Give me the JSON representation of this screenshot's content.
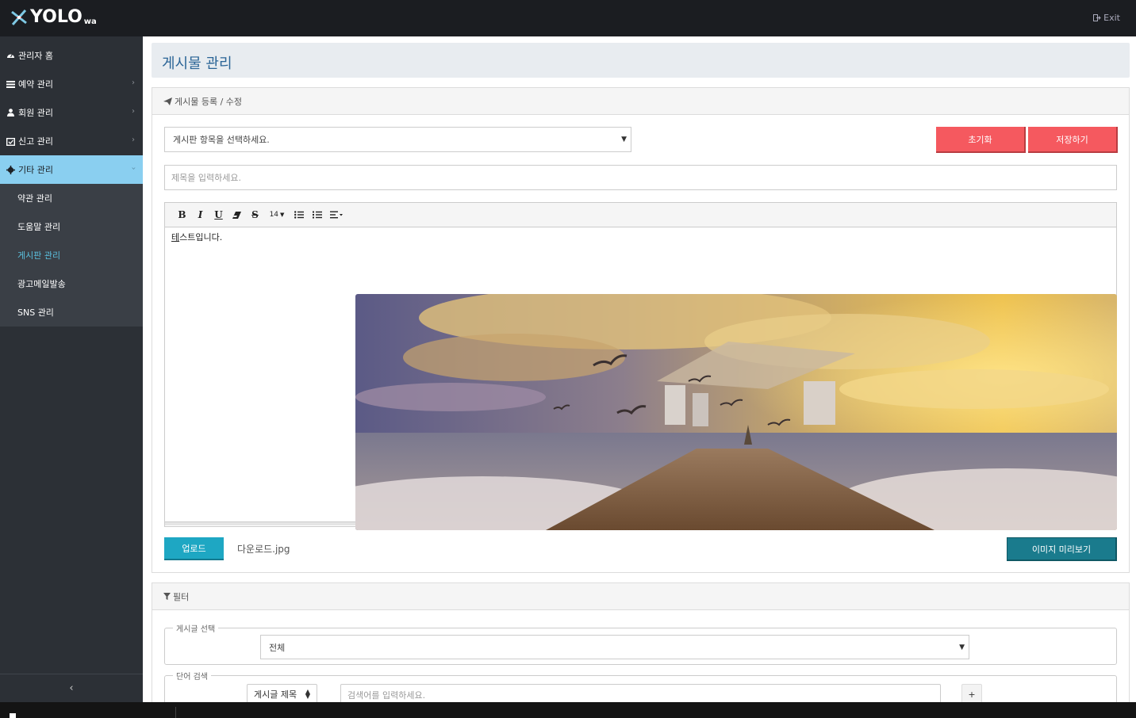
{
  "app": {
    "logo_text": "YOLO",
    "logo_sub": "wa",
    "exit_label": "Exit"
  },
  "sidebar": {
    "items": [
      {
        "label": "관리자 홈",
        "icon": "dashboard-icon",
        "has_chevron": false
      },
      {
        "label": "예약 관리",
        "icon": "list-icon",
        "has_chevron": true
      },
      {
        "label": "회원 관리",
        "icon": "user-icon",
        "has_chevron": true
      },
      {
        "label": "신고 관리",
        "icon": "calendar-check-icon",
        "has_chevron": true
      },
      {
        "label": "기타 관리",
        "icon": "gear-icon",
        "has_chevron": true,
        "active": true
      }
    ],
    "submenu": [
      {
        "label": "약관 관리"
      },
      {
        "label": "도움말 관리"
      },
      {
        "label": "게시판 관리",
        "current": true
      },
      {
        "label": "광고메일발송"
      },
      {
        "label": "SNS 관리"
      }
    ],
    "collapse_glyph": "‹"
  },
  "page": {
    "title": "게시물 관리"
  },
  "edit_panel": {
    "heading": "게시물 등록 / 수정",
    "board_select": "게시판 항목을 선택하세요.",
    "reset_button": "초기화",
    "save_button": "저장하기",
    "title_placeholder": "제목을 입력하세요.",
    "toolbar": {
      "bold": "B",
      "italic": "I",
      "underline": "U",
      "eraser": "eraser-icon",
      "strikethrough": "S",
      "font_size": "14",
      "unordered_list": "list-ul-icon",
      "ordered_list": "list-ol-icon",
      "align": "align-left-icon"
    },
    "editor_text_first": "테",
    "editor_text_rest": "스트입니다.",
    "upload_button": "업로드",
    "file_name": "다운로드.jpg",
    "preview_button": "이미지 미리보기"
  },
  "filter_panel": {
    "heading": "필터",
    "board_legend": "게시글 선택",
    "board_value": "전체",
    "search_legend": "단어 검색",
    "search_field_value": "게시글 제목",
    "search_placeholder": "검색어를 입력하세요.",
    "add_button": "+"
  },
  "colors": {
    "topbar": "#1b1d21",
    "sidebar": "#2c3036",
    "active_item": "#8acff0",
    "title_blue": "#2a6496",
    "red_button": "#f5595f",
    "teal_button": "#1ea7c3",
    "dark_teal_button": "#1a7b8d"
  }
}
